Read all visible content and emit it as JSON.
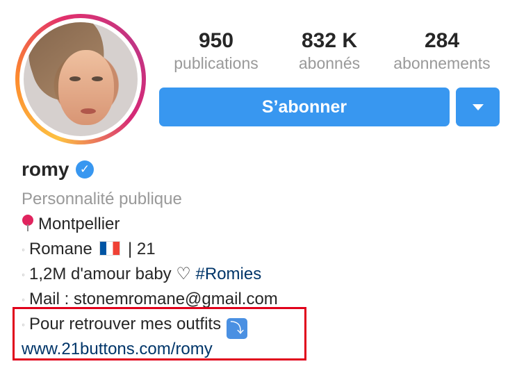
{
  "stats": [
    {
      "num": "950",
      "label": "publications"
    },
    {
      "num": "832 K",
      "label": "abonnés"
    },
    {
      "num": "284",
      "label": "abonnements"
    }
  ],
  "buttons": {
    "follow": "S’abonner"
  },
  "profile": {
    "username": "romy",
    "category": "Personnalité publique",
    "location": "Montpellier",
    "bio": {
      "line1_name": "Romane",
      "line1_age": "| 21",
      "line2_text": "1,2M d'amour baby ♡",
      "line2_hashtag": "#Romies",
      "line3": "Mail : stonemromane@gmail.com",
      "line4": "Pour retrouver mes outfits",
      "bullet": "◦",
      "arrow": "⤵"
    },
    "website": "www.21buttons.com/romy"
  },
  "colors": {
    "accent": "#3897f0",
    "link": "#003569",
    "muted": "#999999",
    "highlight_border": "#e0001b"
  },
  "icons": {
    "verified": "verified-badge-icon",
    "pin": "round-pushpin-icon",
    "flag": "france-flag-icon",
    "arrow": "arrow-curving-down-icon",
    "dropdown": "caret-down-icon"
  }
}
